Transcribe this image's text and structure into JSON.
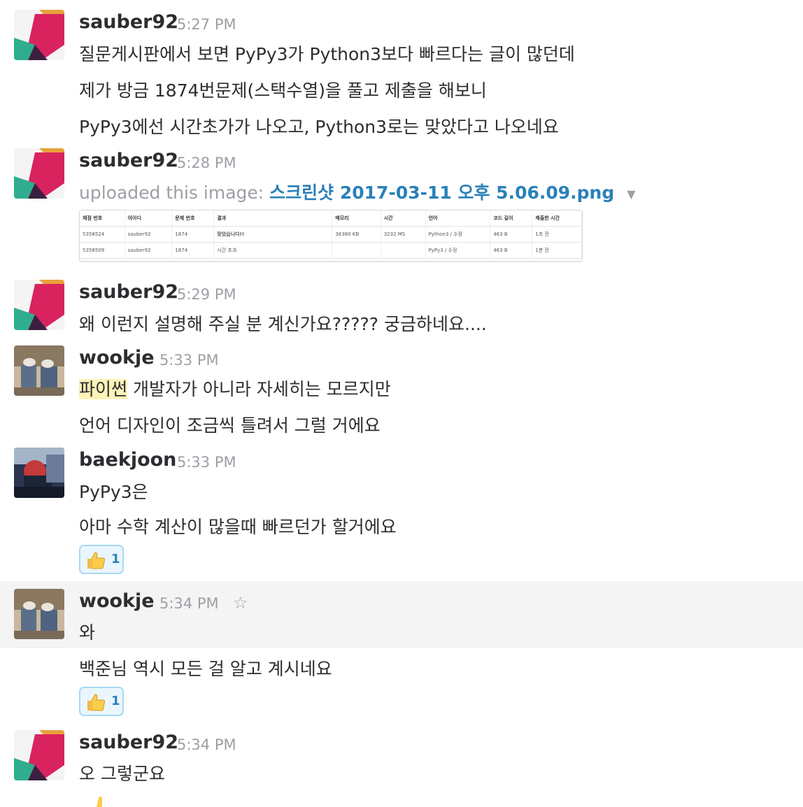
{
  "colors": {
    "text": "#2c2d30",
    "muted": "#9e9ea6",
    "link": "#2a80b9",
    "highlight": "#fdf2b8",
    "reaction_bg": "#eaf6fd",
    "reaction_border": "#a8d9f3"
  },
  "messages": [
    {
      "author": "sauber92",
      "time": "5:27 PM",
      "lines": [
        "질문게시판에서 보면 PyPy3가 Python3보다 빠르다는 글이 많던데",
        "제가 방금 1874번문제(스택수열)을 풀고 제출을 해보니",
        "PyPy3에선 시간초가가 나오고, Python3로는 맞았다고 나오네요"
      ]
    },
    {
      "author": "sauber92",
      "time": "5:28 PM",
      "upload_prefix": "uploaded this image:",
      "file_name": "스크린샷 2017-03-11 오후 5.06.09.png",
      "caret_icon": "caret-down-icon"
    },
    {
      "author": "sauber92",
      "time": "5:29 PM",
      "lines": [
        "왜 이런지 설명해 주실 분 계신가요????? 궁금하네요...."
      ]
    },
    {
      "author": "wookje",
      "time": "5:33 PM",
      "line0_highlight": "파이썬",
      "line0_rest": " 개발자가 아니라 자세히는 모르지만",
      "lines": [
        "언어 디자인이 조금씩 틀려서 그럴 거에요"
      ]
    },
    {
      "author": "baekjoon",
      "time": "5:33 PM",
      "lines": [
        "PyPy3은",
        "아마 수학 계산이 많을때 빠르던가 할거에요"
      ],
      "reaction": {
        "emoji": "thumbs-up-icon",
        "count": "1"
      }
    },
    {
      "author": "wookje",
      "time": "5:34 PM",
      "star_icon": "☆",
      "lines": [
        "와",
        "백준님 역시 모든 걸 알고 계시네요"
      ],
      "reaction": {
        "emoji": "thumbs-up-icon",
        "count": "1"
      }
    },
    {
      "author": "sauber92",
      "time": "5:34 PM",
      "lines": [
        "오 그렇군요"
      ]
    }
  ],
  "upload_table": {
    "headers": [
      "채점 번호",
      "아이디",
      "문제 번호",
      "결과",
      "메모리",
      "시간",
      "언어",
      "코드 길이",
      "제출한 시간"
    ],
    "rows": [
      [
        "5358524",
        "sauber92",
        "1874",
        "맞았습니다!!",
        "36380 KB",
        "3232 MS",
        "Python3 / 수정",
        "463 B",
        "1초 전"
      ],
      [
        "5358509",
        "sauber92",
        "1874",
        "시간 초과",
        "",
        "",
        "PyPy3 / 수정",
        "463 B",
        "1분 전"
      ]
    ]
  }
}
